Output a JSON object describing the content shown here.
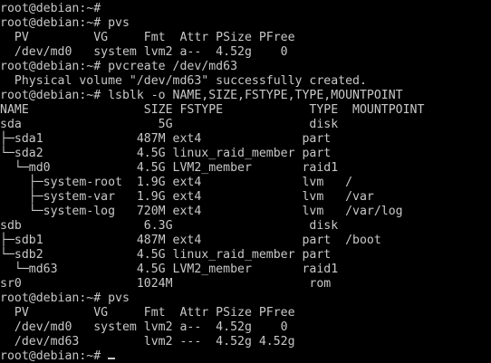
{
  "theme": {
    "background": "#000000",
    "foreground": "#c8c8c8"
  },
  "terminal": {
    "lines": [
      "root@debian:~#",
      "root@debian:~# pvs",
      "  PV         VG     Fmt  Attr PSize PFree",
      "  /dev/md0   system lvm2 a--  4.52g    0",
      "root@debian:~# pvcreate /dev/md63",
      "  Physical volume \"/dev/md63\" successfully created.",
      "root@debian:~# lsblk -o NAME,SIZE,FSTYPE,TYPE,MOUNTPOINT",
      "NAME                SIZE FSTYPE            TYPE  MOUNTPOINT",
      "sda                   5G                   disk",
      "├─sda1             487M ext4              part",
      "└─sda2             4.5G linux_raid_member part",
      "  └─md0            4.5G LVM2_member       raid1",
      "    ├─system-root  1.9G ext4              lvm   /",
      "    ├─system-var   1.9G ext4              lvm   /var",
      "    └─system-log   720M ext4              lvm   /var/log",
      "sdb                 6.3G                   disk",
      "├─sdb1             487M ext4              part  /boot",
      "└─sdb2             4.5G linux_raid_member part",
      "  └─md63           4.5G LVM2_member       raid1",
      "sr0                1024M                   rom",
      "root@debian:~# pvs",
      "  PV         VG     Fmt  Attr PSize PFree",
      "  /dev/md0   system lvm2 a--  4.52g    0",
      "  /dev/md63         lvm2 ---  4.52g 4.52g"
    ],
    "prompt": "root@debian:~# "
  }
}
